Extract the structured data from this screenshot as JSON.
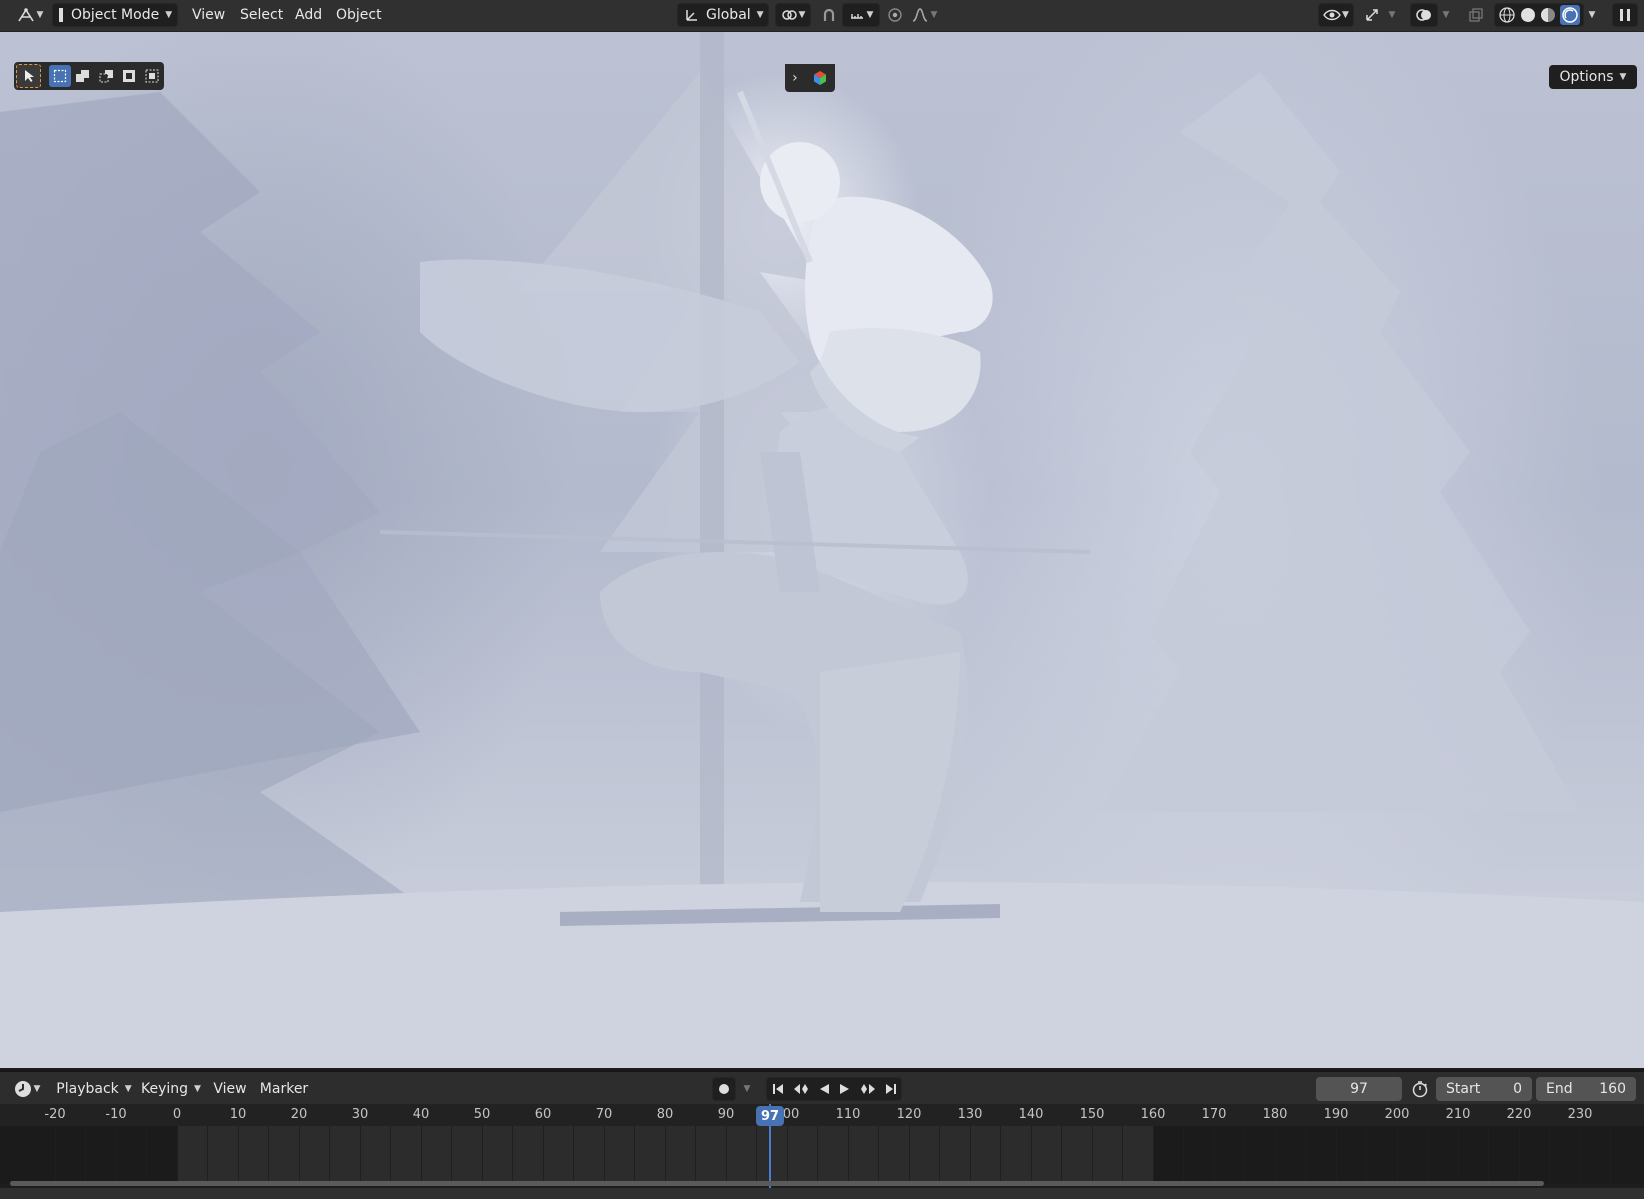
{
  "header": {
    "mode": "Object Mode",
    "menus": [
      "View",
      "Select",
      "Add",
      "Object"
    ],
    "orientation": "Global",
    "icons": [
      "editor-type-icon",
      "object-mode-icon",
      "transform-orientation-icon",
      "pivot-icon",
      "snap-icon",
      "snap-increment-icon",
      "proportional-edit-icon",
      "falloff-icon",
      "visibility-icon",
      "gizmo-icon",
      "overlay-icon",
      "xray-icon",
      "wireframe-shading-icon",
      "solid-shading-icon",
      "material-shading-icon",
      "rendered-shading-icon",
      "pause-icon"
    ]
  },
  "viewport": {
    "options_label": "Options",
    "scene": "rendered-3d-skier-scene"
  },
  "timeline": {
    "menus": [
      "Playback",
      "Keying",
      "View",
      "Marker"
    ],
    "current_frame": "97",
    "start_label": "Start",
    "start_value": "0",
    "end_label": "End",
    "end_value": "160",
    "ruler_ticks": [
      "-20",
      "-10",
      "0",
      "10",
      "20",
      "30",
      "40",
      "50",
      "60",
      "70",
      "80",
      "90",
      "00",
      "110",
      "120",
      "130",
      "140",
      "150",
      "160",
      "170",
      "180",
      "190",
      "200",
      "210",
      "220",
      "230"
    ],
    "playhead_label": "97"
  },
  "colors": {
    "accent": "#4772b3",
    "header_bg": "#303030",
    "tool_active_border": "#e39a3a"
  }
}
